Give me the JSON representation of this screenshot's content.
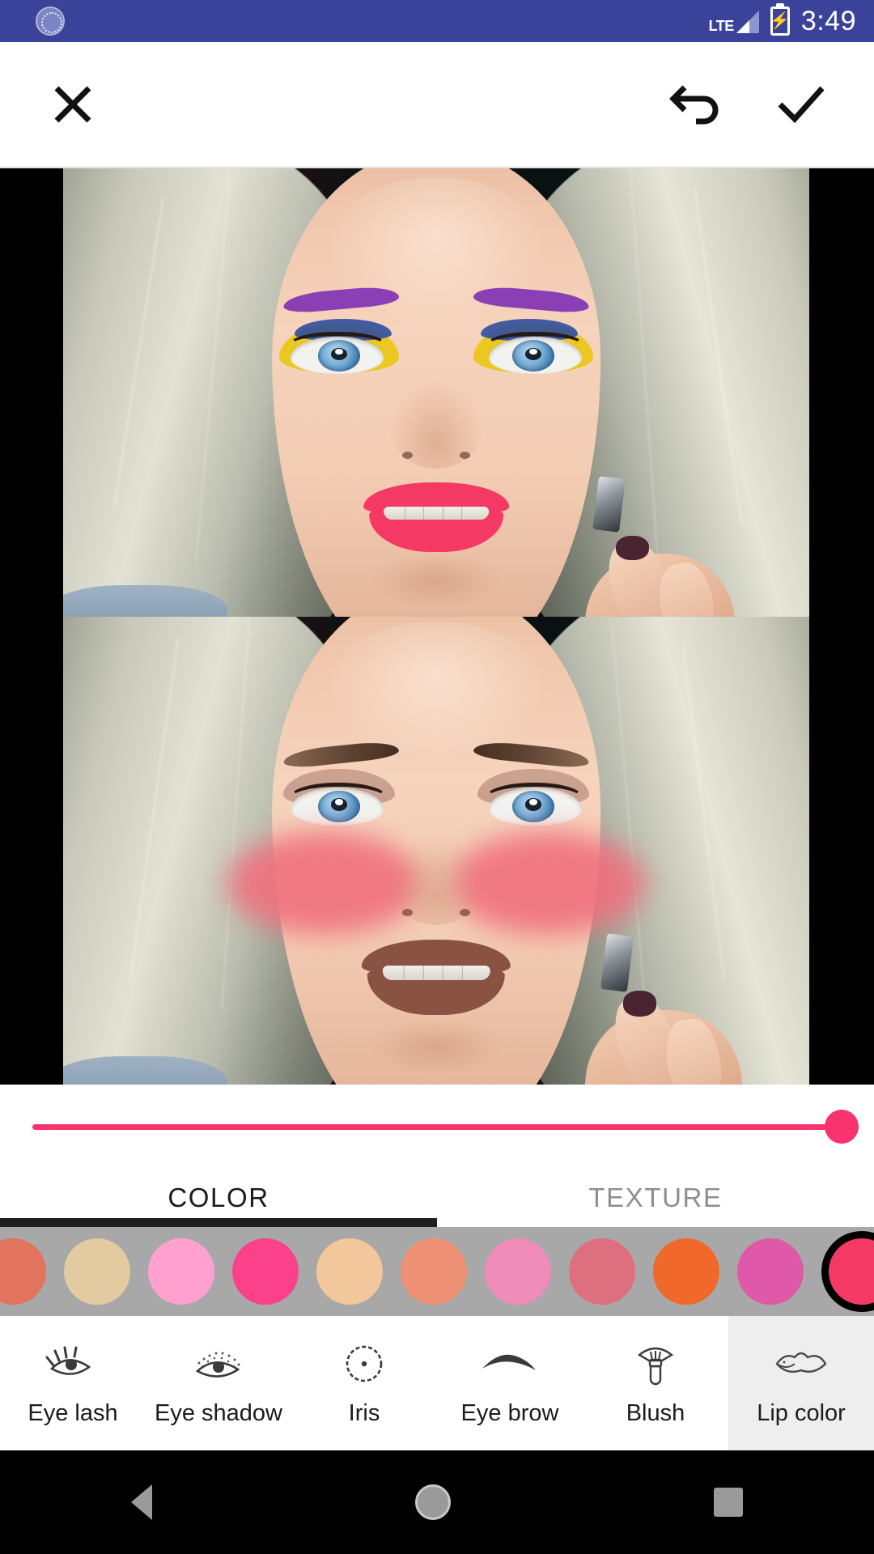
{
  "status_bar": {
    "app_icon": "app-badge-icon",
    "network_label": "LTE",
    "signal_icon": "signal-bars-icon",
    "battery_icon": "battery-charging-icon",
    "time": "3:49",
    "background_color": "#3b4299"
  },
  "toolbar": {
    "close_icon": "close-x-icon",
    "undo_icon": "undo-arrow-icon",
    "confirm_icon": "checkmark-icon"
  },
  "preview": {
    "top_panel": {
      "label": "before-makeup-preview",
      "eyebrow_color": "#8a3fb5",
      "eyeshadow_color": "#e8c513",
      "eyeliner_color": "#2f4e9e",
      "iris_color": "#6aa7d4",
      "lip_color": "#f43a64"
    },
    "bottom_panel": {
      "label": "after-makeup-preview",
      "eyebrow_color": "#6b4f3c",
      "blush_color": "#f0707e",
      "iris_color": "#7fb3da",
      "lip_color": "#8a5243"
    }
  },
  "slider": {
    "name": "intensity-slider",
    "value": 100,
    "min": 0,
    "max": 100,
    "track_color": "#f8336f",
    "thumb_color": "#f8336f"
  },
  "tabs": [
    {
      "label": "COLOR",
      "active": true
    },
    {
      "label": "TEXTURE",
      "active": false
    }
  ],
  "swatches": {
    "selected_index": 10,
    "colors": [
      "#e2735c",
      "#e4caa0",
      "#ffa0cf",
      "#fa4189",
      "#f2c79b",
      "#ef9175",
      "#f08cb8",
      "#de6f7f",
      "#f0682a",
      "#e058a8",
      "#f43a64"
    ]
  },
  "categories": [
    {
      "label": "Eye lash",
      "icon": "eyelash-icon",
      "selected": false
    },
    {
      "label": "Eye shadow",
      "icon": "eyeshadow-icon",
      "selected": false
    },
    {
      "label": "Iris",
      "icon": "iris-icon",
      "selected": false
    },
    {
      "label": "Eye brow",
      "icon": "eyebrow-icon",
      "selected": false
    },
    {
      "label": "Blush",
      "icon": "blush-brush-icon",
      "selected": false
    },
    {
      "label": "Lip color",
      "icon": "lips-icon",
      "selected": true
    }
  ],
  "android_nav": {
    "back_icon": "nav-back-triangle-icon",
    "home_icon": "nav-home-circle-icon",
    "recents_icon": "nav-recents-square-icon"
  }
}
